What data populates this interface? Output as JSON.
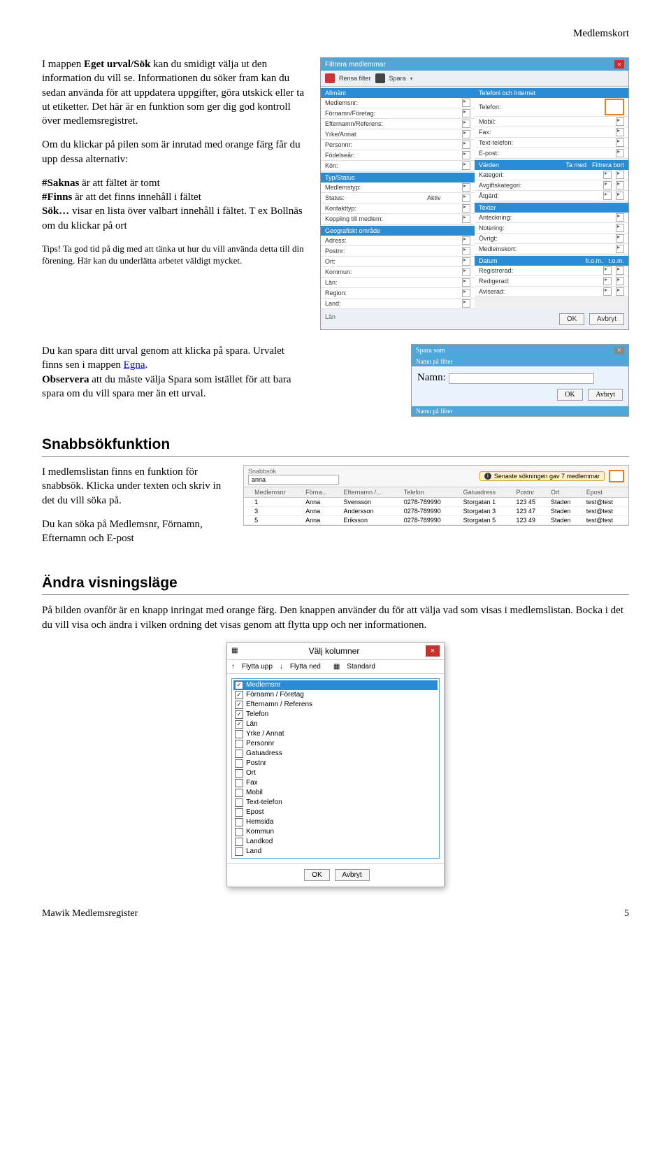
{
  "header": {
    "doc_title": "Medlemskort"
  },
  "intro": {
    "p1a": "I mappen ",
    "p1b": "Eget urval/Sök",
    "p1c": " kan du smidigt välja ut den information du vill se. Informationen du söker fram kan du sedan använda för att uppdatera uppgifter, göra utskick eller ta ut etiketter. Det här är en funktion som ger dig god kontroll över medlemsregistret.",
    "p2": "Om du klickar på pilen som är inrutad med orange färg får du upp dessa alternativ:",
    "l1a": "#Saknas",
    "l1b": " är att fältet är tomt",
    "l2a": "#Finns",
    "l2b": " är att det finns innehåll i fältet",
    "l3a": "Sök…",
    "l3b": " visar en lista över valbart innehåll i fältet. T ex Bollnäs om du klickar på ort",
    "tips": "Tips! Ta god tid på dig med att tänka ut hur du vill använda detta till din förening. Här kan du underlätta arbetet väldigt mycket.",
    "p3a": "Du kan spara ditt urval genom att klicka på spara. Urvalet finns sen i mappen ",
    "p3link": "Egna",
    "p3dot": ".",
    "p3b": "Observera",
    "p3c": " att du måste välja Spara som istället för att bara spara om du vill spara mer än ett urval."
  },
  "filter_dialog": {
    "title": "Filtrera medlemmar",
    "rensa": "Rensa filter",
    "spara": "Spara",
    "sec_allmant": "Allmänt",
    "sec_tel": "Telefoni och Internet",
    "allmant": [
      "Medlemsnr:",
      "Förnamn/Företag:",
      "Efternamn/Referens:",
      "Yrke/Annat",
      "Personnr:",
      "Födelseår:",
      "Kön:"
    ],
    "tel": [
      "Telefon:",
      "Mobil:",
      "Fax:",
      "Text-telefon:",
      "E-post:"
    ],
    "varden_hdr": "Värden",
    "tamed": "Ta med",
    "fbort": "Filtrera bort",
    "varden": [
      "Kategori:",
      "Avgiftskategori:",
      "Åtgärd:"
    ],
    "sec_typ": "Typ/Status",
    "typ": [
      "Medlemstyp:",
      "Status:",
      "Kontakttyp:",
      "Koppling till medlem:"
    ],
    "status_val": "Aktiv",
    "sec_texter": "Texter",
    "texter": [
      "Anteckning:",
      "Notering:",
      "Övrigt:",
      "Medlemskort:"
    ],
    "sec_geo": "Geografiskt område",
    "geo": [
      "Adress:",
      "Postnr:",
      "Ort:",
      "Kommun:",
      "Län:",
      "Region:",
      "Land:"
    ],
    "sec_datum": "Datum",
    "from": "fr.o.m.",
    "tom": "t.o.m.",
    "datum": [
      "Registrerad:",
      "Redigerad:",
      "Aviserad:"
    ],
    "status_line": "Län",
    "ok": "OK",
    "avbryt": "Avbryt"
  },
  "saveas": {
    "title": "Spara som",
    "sec": "Namn på filter",
    "namn_lbl": "Namn:",
    "sec2": "Namn på filter",
    "ok": "OK",
    "avbryt": "Avbryt"
  },
  "snabb": {
    "h": "Snabbsökfunktion",
    "p1": "I medlemslistan finns en funktion för snabbsök. Klicka under texten och skriv in det du vill söka på.",
    "p2": "Du kan söka på Medlemsnr, Förnamn, Efternamn och E-post",
    "lbl": "Snabbsök",
    "val": "anna",
    "info": "Senaste sökningen gav 7 medlemmar",
    "cols": [
      "",
      "Medlemsnr",
      "Förna...",
      "Efternamn /...",
      "Telefon",
      "Gatuadress",
      "Postnr",
      "Ort",
      "Epost"
    ],
    "rows": [
      [
        "",
        "1",
        "Anna",
        "Svensson",
        "0278-789990",
        "Storgatan 1",
        "123 45",
        "Staden",
        "test@test"
      ],
      [
        "",
        "3",
        "Anna",
        "Andersson",
        "0278-789990",
        "Storgatan 3",
        "123 47",
        "Staden",
        "test@test"
      ],
      [
        "",
        "5",
        "Anna",
        "Eriksson",
        "0278-789990",
        "Storgatan 5",
        "123 49",
        "Staden",
        "test@test"
      ]
    ]
  },
  "vis": {
    "h": "Ändra visningsläge",
    "p": "På bilden ovanför är en knapp inringat med orange färg. Den knappen använder du för att välja vad som visas i medlemslistan. Bocka i det du vill visa och ändra i vilken ordning det visas genom att flytta upp och ner informationen."
  },
  "cols_dialog": {
    "title": "Välj kolumner",
    "up": "Flytta upp",
    "down": "Flytta ned",
    "std": "Standard",
    "items": [
      {
        "c": true,
        "t": "Medlemsnr",
        "sel": true
      },
      {
        "c": true,
        "t": "Förnamn / Företag"
      },
      {
        "c": true,
        "t": "Efternamn / Referens"
      },
      {
        "c": true,
        "t": "Telefon"
      },
      {
        "c": true,
        "t": "Län"
      },
      {
        "c": false,
        "t": "Yrke / Annat"
      },
      {
        "c": false,
        "t": "Personnr"
      },
      {
        "c": false,
        "t": "Gatuadress"
      },
      {
        "c": false,
        "t": "Postnr"
      },
      {
        "c": false,
        "t": "Ort"
      },
      {
        "c": false,
        "t": "Fax"
      },
      {
        "c": false,
        "t": "Mobil"
      },
      {
        "c": false,
        "t": "Text-telefon"
      },
      {
        "c": false,
        "t": "Epost"
      },
      {
        "c": false,
        "t": "Hemsida"
      },
      {
        "c": false,
        "t": "Kommun"
      },
      {
        "c": false,
        "t": "Landkod"
      },
      {
        "c": false,
        "t": "Land"
      }
    ],
    "ok": "OK",
    "avbryt": "Avbryt"
  },
  "footer": {
    "left": "Mawik Medlemsregister",
    "right": "5"
  }
}
